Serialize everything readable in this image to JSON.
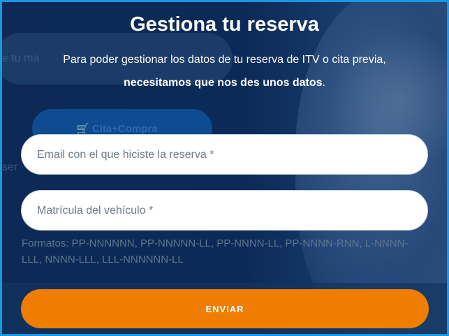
{
  "modal": {
    "title": "Gestiona tu reserva",
    "subtitle_line1": "Para poder gestionar los datos de tu reserva de ITV o cita previa,",
    "subtitle_line2": "necesitamos que nos des unos datos",
    "subtitle_line2_end": "."
  },
  "form": {
    "email_placeholder": "Email con el que hiciste la reserva *",
    "email_value": "",
    "plate_placeholder": "Matrícula del vehículo *",
    "plate_value": "",
    "formats_hint": "Formatos: PP-NNNNNN, PP-NNNNN-LL, PP-NNNN-LL, PP-NNNN-RNN, L-NNNN-LLL, NNNN-LLL, LLL-NNNNNN-LL",
    "submit_label": "ENVIAR"
  },
  "background": {
    "pill_text": "e tu ma",
    "button_text": "Cita+Compra",
    "left_text": "ser"
  },
  "colors": {
    "frame": "#1797e6",
    "overlay": "#0b2a57",
    "accent": "#ef7d00"
  }
}
